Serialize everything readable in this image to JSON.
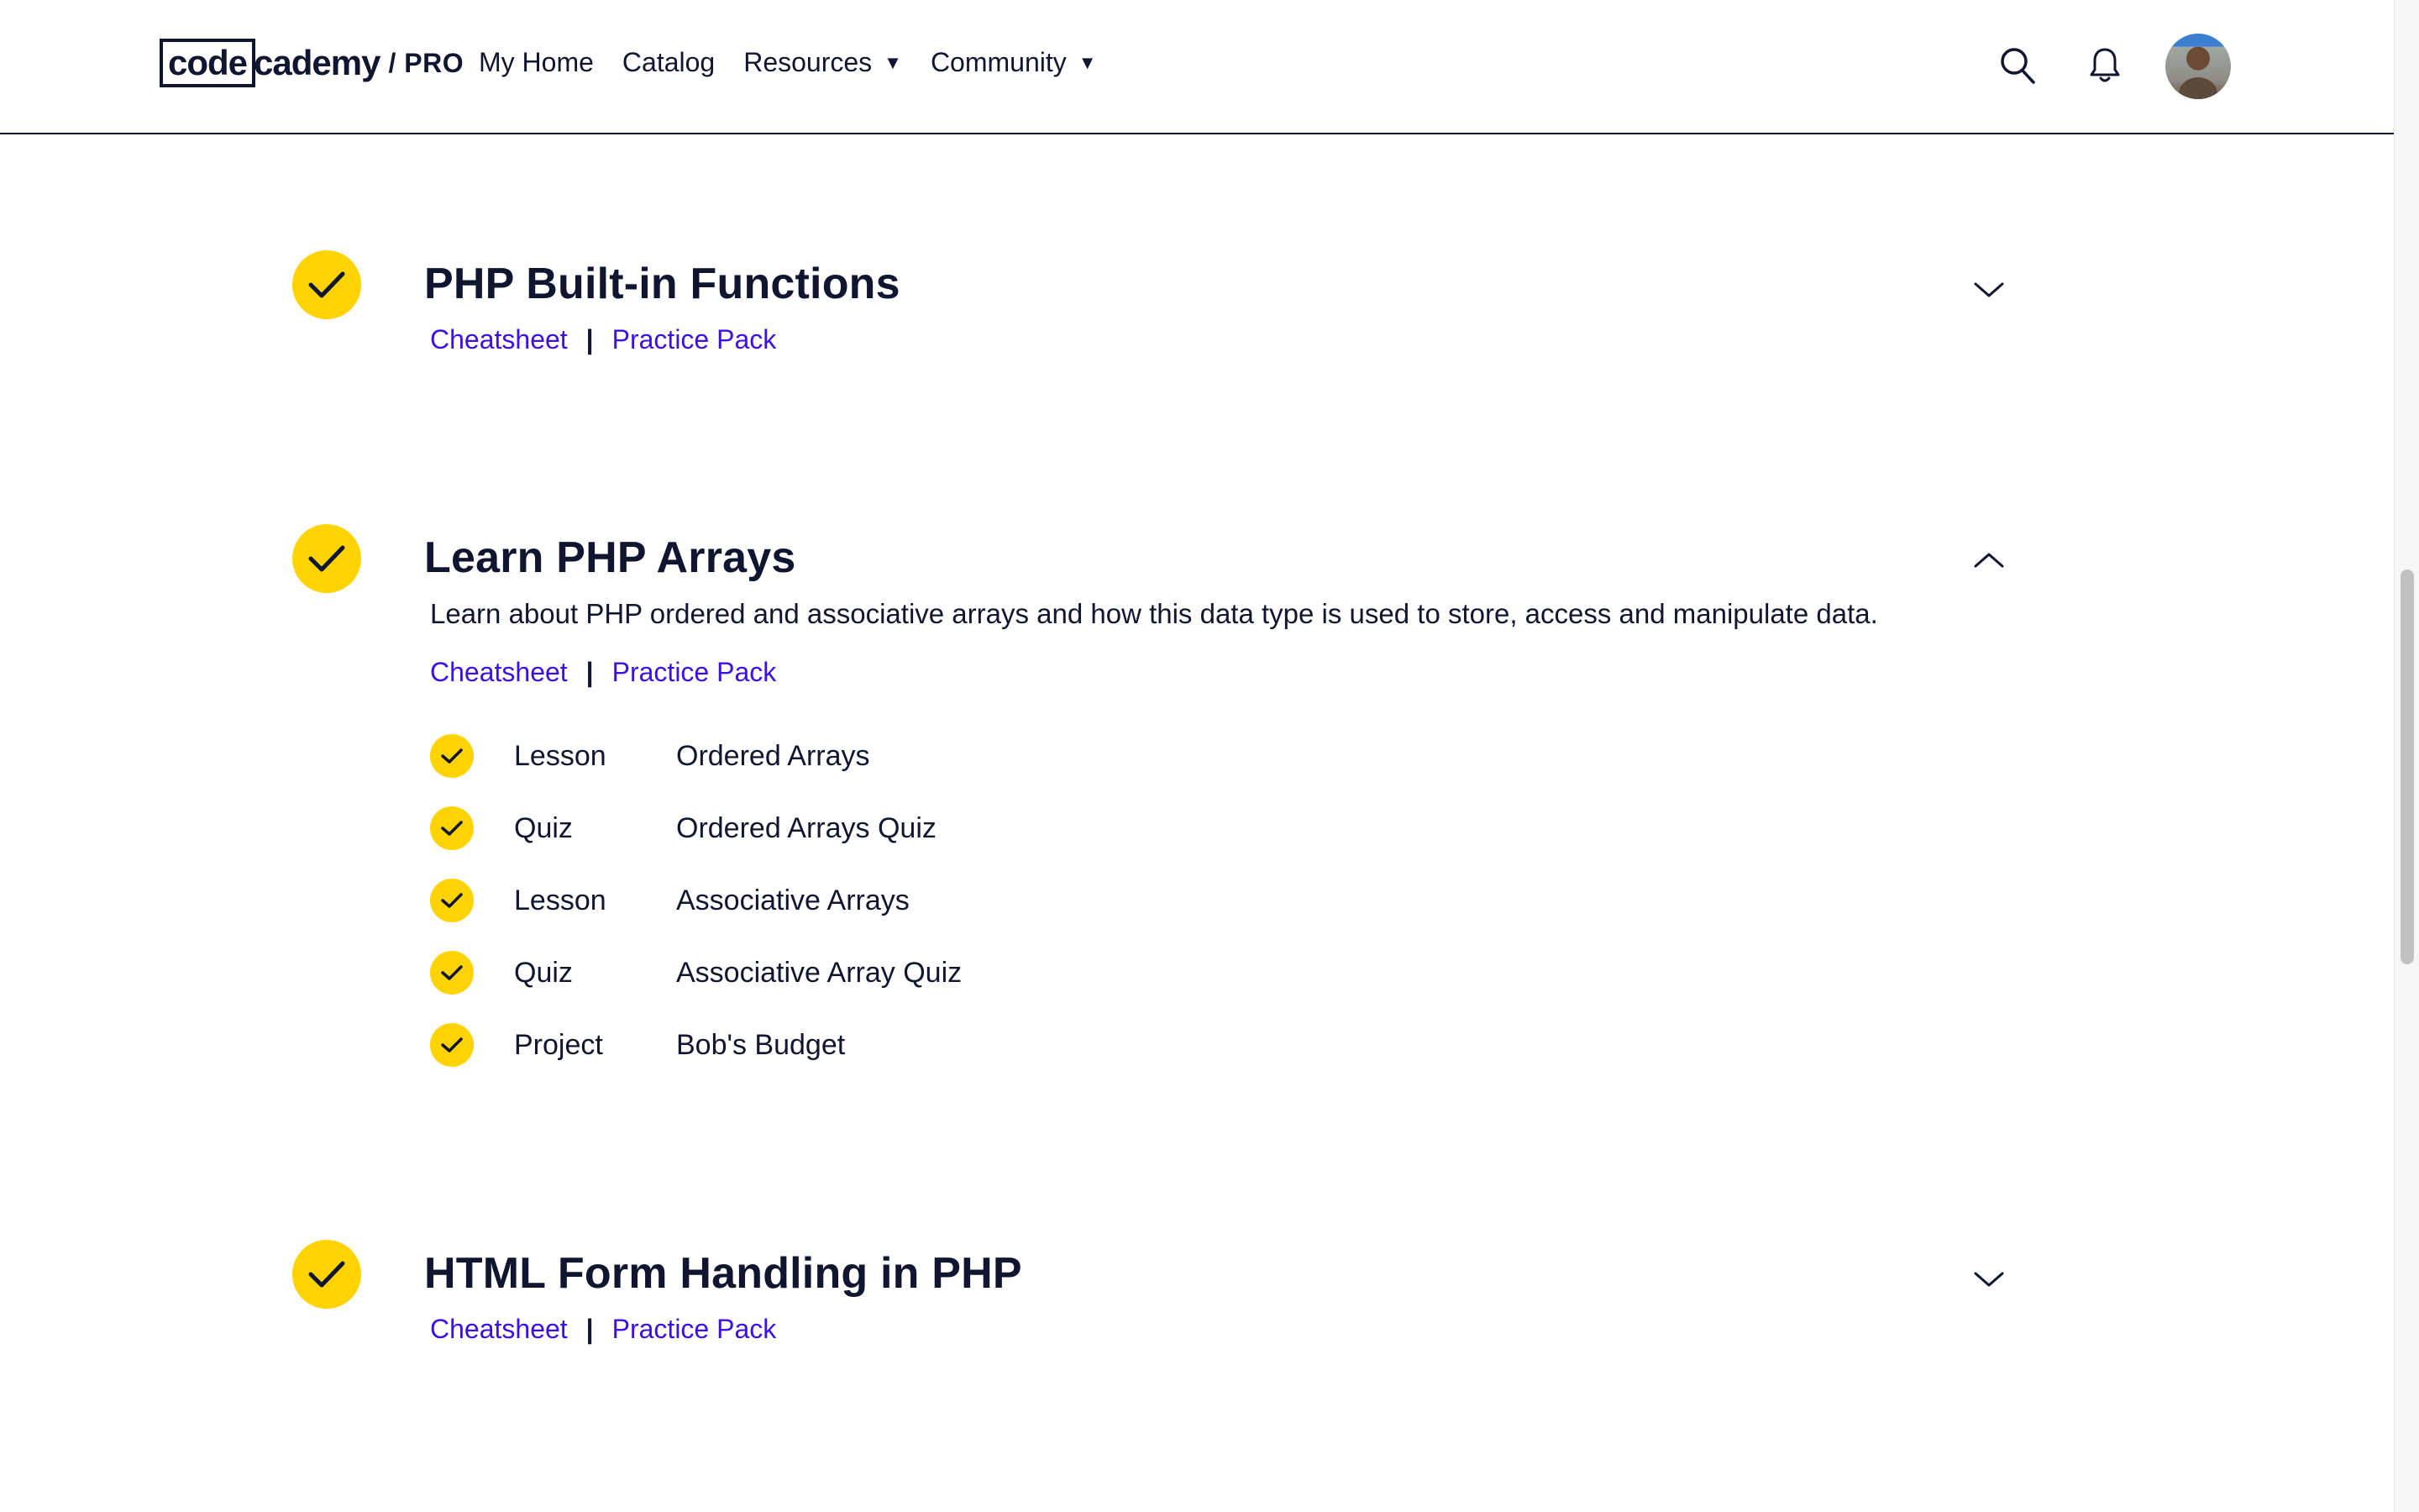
{
  "brand": {
    "logo_box": "code",
    "logo_rest": "cademy",
    "logo_pro": "/ PRO"
  },
  "nav": {
    "items": [
      {
        "label": "My Home"
      },
      {
        "label": "Catalog"
      },
      {
        "label": "Resources",
        "caret": "▼"
      },
      {
        "label": "Community",
        "caret": "▼"
      }
    ]
  },
  "header_icons": [
    "search-icon",
    "bell-icon"
  ],
  "colors": {
    "accent_yellow": "#ffd300",
    "link_purple": "#3a10e5",
    "text_navy": "#10162f"
  },
  "modules": [
    {
      "title": "PHP Built-in Functions",
      "expanded": false,
      "links": [
        "Cheatsheet",
        "Practice Pack"
      ],
      "separator": "|"
    },
    {
      "title": "Learn PHP Arrays",
      "expanded": true,
      "description": "Learn about PHP ordered and associative arrays and how this data type is used to store, access and manipulate data.",
      "links": [
        "Cheatsheet",
        "Practice Pack"
      ],
      "separator": "|",
      "items": [
        {
          "type": "Lesson",
          "name": "Ordered Arrays"
        },
        {
          "type": "Quiz",
          "name": "Ordered Arrays Quiz"
        },
        {
          "type": "Lesson",
          "name": "Associative Arrays"
        },
        {
          "type": "Quiz",
          "name": "Associative Array Quiz"
        },
        {
          "type": "Project",
          "name": "Bob's Budget"
        }
      ]
    },
    {
      "title": "HTML Form Handling in PHP",
      "expanded": false,
      "links": [
        "Cheatsheet",
        "Practice Pack"
      ],
      "separator": "|"
    }
  ]
}
